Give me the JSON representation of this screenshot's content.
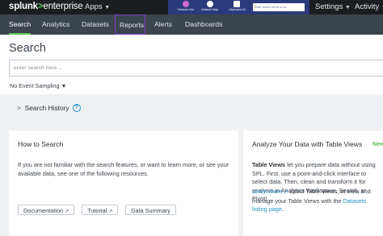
{
  "topbar": {
    "logo_brand": "splunk",
    "logo_symbol": ">",
    "logo_product": "enterprise",
    "apps_label": "Apps",
    "tray": [
      {
        "label": "Network Info",
        "icon": "network-info-icon",
        "color": "#d06bd0"
      },
      {
        "label": "Network Map",
        "icon": "network-map-icon",
        "color": "#ffffff"
      },
      {
        "label": "Clipboard (0)",
        "icon": "clipboard-icon",
        "color": "#ffffff"
      }
    ],
    "tray_search_placeholder": "Enter search terms or url",
    "settings_label": "Settings",
    "activity_label": "Activity"
  },
  "nav": {
    "tabs": [
      {
        "label": "Search",
        "active": true
      },
      {
        "label": "Analytics"
      },
      {
        "label": "Datasets"
      },
      {
        "label": "Reports",
        "highlighted": true
      },
      {
        "label": "Alerts"
      },
      {
        "label": "Dashboards"
      }
    ]
  },
  "search": {
    "title": "Search",
    "placeholder": "enter search here...",
    "sampling": "No Event Sampling",
    "history_label": "Search History",
    "help_icon": "?"
  },
  "how_to": {
    "title": "How to Search",
    "body": "If you are not familiar with the search features, or want to learn more, or see your available data, see one of the following resources.",
    "buttons": [
      "Documentation",
      "Tutorial",
      "Data Summary"
    ]
  },
  "table_views": {
    "title": "Analyze Your Data with Table Views",
    "badge": "New",
    "body_bold": "Table Views",
    "body": "let you prepare data without using SPL. First, use a point-and-click interface to select data. Then, clean and transform it for analysis in Analytics Workspace, Search, or Pivot!",
    "learn_more": "Learn more",
    "body2": "about Table Views, or view and manage your Table Views with the",
    "listing_link": "Datasets listing page",
    "body3": "."
  },
  "colors": {
    "accent_green": "#5cc05c",
    "highlight_purple": "#7a3fc6",
    "link_blue": "#1e93c6",
    "nav_bg": "#3c444d",
    "topbar_bg": "#1b1e21"
  }
}
